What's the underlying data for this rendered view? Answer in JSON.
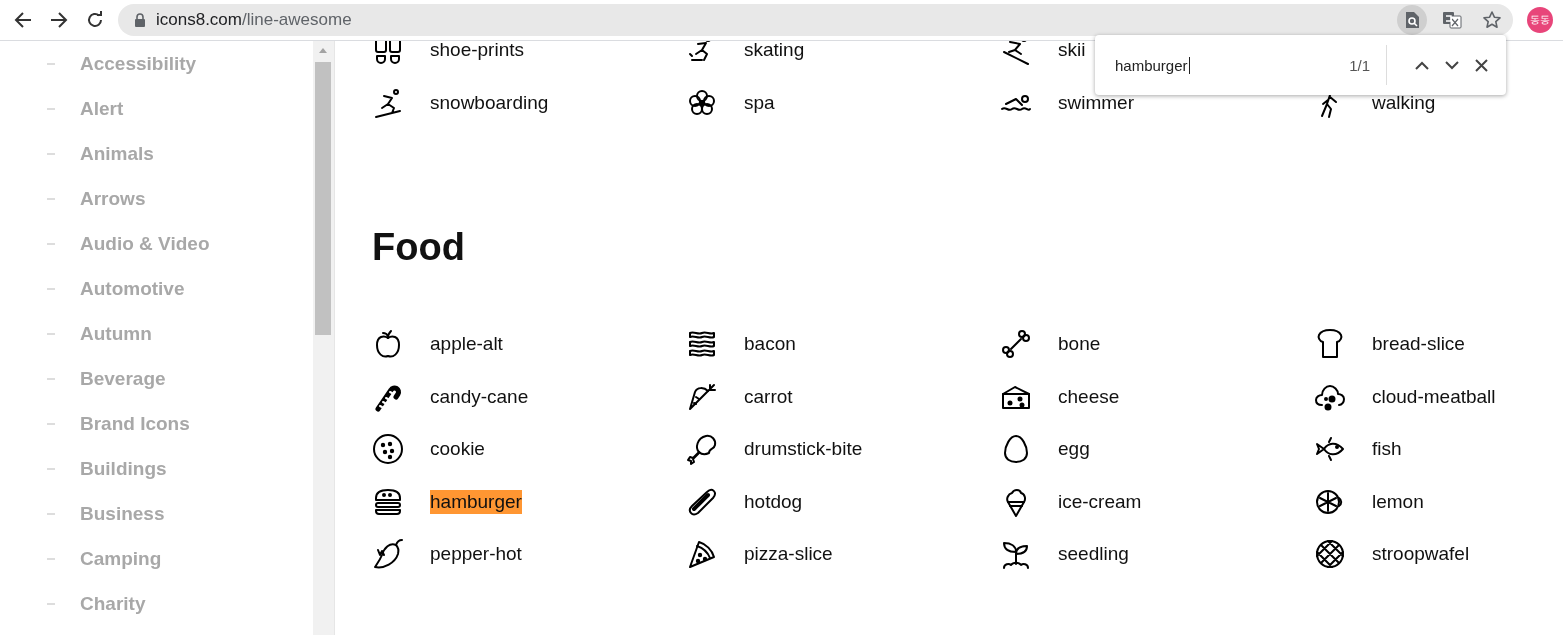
{
  "browser": {
    "url": {
      "host": "icons8.com",
      "path": "/line-awesome"
    },
    "find_active": true,
    "avatar": "동동"
  },
  "sidebar": {
    "items": [
      {
        "label": "Accessibility"
      },
      {
        "label": "Alert"
      },
      {
        "label": "Animals"
      },
      {
        "label": "Arrows"
      },
      {
        "label": "Audio & Video"
      },
      {
        "label": "Automotive"
      },
      {
        "label": "Autumn"
      },
      {
        "label": "Beverage"
      },
      {
        "label": "Brand Icons"
      },
      {
        "label": "Buildings"
      },
      {
        "label": "Business"
      },
      {
        "label": "Camping"
      },
      {
        "label": "Charity"
      }
    ]
  },
  "sections": [
    {
      "rows": [
        [
          {
            "label": "shoe-prints",
            "highlighted": false
          },
          {
            "label": "skating",
            "highlighted": false
          },
          {
            "label": "skii",
            "highlighted": false
          }
        ],
        [
          {
            "label": "snowboarding",
            "highlighted": false
          },
          {
            "label": "spa",
            "highlighted": false
          },
          {
            "label": "swimmer",
            "highlighted": false
          },
          {
            "label": "walking",
            "highlighted": false
          }
        ]
      ]
    },
    {
      "title": "Food",
      "rows": [
        [
          {
            "label": "apple-alt",
            "highlighted": false
          },
          {
            "label": "bacon",
            "highlighted": false
          },
          {
            "label": "bone",
            "highlighted": false
          },
          {
            "label": "bread-slice",
            "highlighted": false
          }
        ],
        [
          {
            "label": "candy-cane",
            "highlighted": false
          },
          {
            "label": "carrot",
            "highlighted": false
          },
          {
            "label": "cheese",
            "highlighted": false
          },
          {
            "label": "cloud-meatball",
            "highlighted": false
          }
        ],
        [
          {
            "label": "cookie",
            "highlighted": false
          },
          {
            "label": "drumstick-bite",
            "highlighted": false
          },
          {
            "label": "egg",
            "highlighted": false
          },
          {
            "label": "fish",
            "highlighted": false
          }
        ],
        [
          {
            "label": "hamburger",
            "highlighted": true
          },
          {
            "label": "hotdog",
            "highlighted": false
          },
          {
            "label": "ice-cream",
            "highlighted": false
          },
          {
            "label": "lemon",
            "highlighted": false
          }
        ],
        [
          {
            "label": "pepper-hot",
            "highlighted": false
          },
          {
            "label": "pizza-slice",
            "highlighted": false
          },
          {
            "label": "seedling",
            "highlighted": false
          },
          {
            "label": "stroopwafel",
            "highlighted": false
          }
        ]
      ]
    }
  ],
  "find_bar": {
    "query": "hamburger",
    "count": "1/1"
  }
}
